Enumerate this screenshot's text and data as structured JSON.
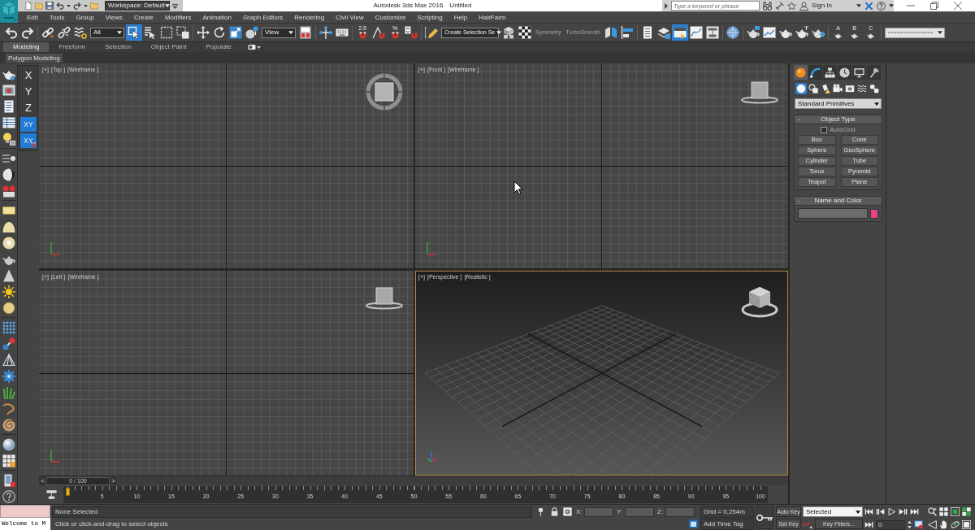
{
  "title_bar": {
    "workspace": "Workspace: Default",
    "title": "Autodesk 3ds Max 2016",
    "document": "Untitled",
    "search": {
      "placeholder": "Type a keyword or phrase"
    },
    "sign_in": "Sign In"
  },
  "menu_bar": [
    "Edit",
    "Tools",
    "Group",
    "Views",
    "Create",
    "Modifiers",
    "Animation",
    "Graph Editors",
    "Rendering",
    "Civil View",
    "Customize",
    "Scripting",
    "Help",
    "HairFarm"
  ],
  "main_toolbar": {
    "groups": [
      {
        "items": [
          {
            "kind": "button",
            "selected": false
          },
          {
            "kind": "button",
            "selected": false
          }
        ]
      },
      {
        "items": [
          {
            "kind": "button",
            "selected": false
          },
          {
            "kind": "button",
            "selected": false
          },
          {
            "kind": "button",
            "selected": false
          },
          {
            "kind": "dropdown",
            "value": "All"
          },
          {
            "kind": "button",
            "selected": true
          },
          {
            "kind": "button",
            "selected": false
          },
          {
            "kind": "button",
            "selected": false
          },
          {
            "kind": "button",
            "selected": false
          }
        ]
      },
      {
        "items": [
          {
            "kind": "button",
            "selected": false
          },
          {
            "kind": "button",
            "selected": false
          },
          {
            "kind": "button",
            "selected": false
          },
          {
            "kind": "button",
            "selected": false
          },
          {
            "kind": "dropdown",
            "value": "View"
          },
          {
            "kind": "button",
            "selected": false
          }
        ]
      },
      {
        "items": [
          {
            "kind": "button",
            "selected": false
          },
          {
            "kind": "button",
            "selected": false
          }
        ]
      },
      {
        "items": [
          {
            "kind": "button",
            "label": "2.5",
            "selected": false
          },
          {
            "kind": "button",
            "selected": false
          },
          {
            "kind": "button",
            "label": "%",
            "selected": false
          },
          {
            "kind": "button",
            "selected": false
          }
        ]
      },
      {
        "items": [
          {
            "kind": "button",
            "selected": false
          },
          {
            "kind": "field",
            "value": "Create Selection Se"
          },
          {
            "kind": "button",
            "selected": false
          },
          {
            "kind": "button",
            "selected": false
          },
          {
            "kind": "command",
            "label": "Symmetry",
            "disabled": true
          },
          {
            "kind": "command",
            "label": "TurboSmooth",
            "disabled": true
          },
          {
            "kind": "button",
            "selected": false
          },
          {
            "kind": "button",
            "selected": false
          }
        ]
      },
      {
        "items": [
          {
            "kind": "button",
            "selected": false
          },
          {
            "kind": "button",
            "selected": false
          },
          {
            "kind": "button",
            "selected": true
          },
          {
            "kind": "button",
            "selected": false
          },
          {
            "kind": "button",
            "selected": false
          }
        ]
      },
      {
        "items": [
          {
            "kind": "button",
            "selected": false
          }
        ]
      },
      {
        "items": [
          {
            "kind": "button",
            "selected": false
          },
          {
            "kind": "button",
            "selected": false
          },
          {
            "kind": "button",
            "selected": false
          },
          {
            "kind": "button",
            "selected": false
          },
          {
            "kind": "button",
            "selected": false
          }
        ]
      },
      {
        "items": [
          {
            "kind": "button",
            "label": "A",
            "selected": false
          },
          {
            "kind": "button",
            "label": "B",
            "selected": false
          },
          {
            "kind": "button",
            "label": "C",
            "selected": false
          }
        ]
      },
      {
        "items": [
          {
            "kind": "dropdown"
          }
        ]
      }
    ]
  },
  "ribbon": {
    "tabs": [
      {
        "label": "Modeling",
        "selected": true
      },
      {
        "label": "Freeform",
        "selected": false
      },
      {
        "label": "Selection",
        "selected": false
      },
      {
        "label": "Object Paint",
        "selected": false
      },
      {
        "label": "Populate",
        "selected": false
      }
    ],
    "panel": "Polygon Modeling"
  },
  "axis_constraints": [
    {
      "label": "X",
      "selected": false
    },
    {
      "label": "Y",
      "selected": false
    },
    {
      "label": "Z",
      "selected": false
    },
    {
      "label": "XY",
      "selected": true
    },
    {
      "label": "XY",
      "selected": true
    }
  ],
  "viewports": [
    {
      "kind": "orthographic",
      "labels": [
        "[+]",
        "[Top ]",
        "[Wireframe ]"
      ],
      "selected": false
    },
    {
      "kind": "orthographic",
      "labels": [
        "[+]",
        "[Front ]",
        "[Wireframe ]"
      ],
      "selected": false
    },
    {
      "kind": "orthographic",
      "labels": [
        "[+]",
        "[Left ]",
        "[Wireframe ]"
      ],
      "selected": false
    },
    {
      "kind": "perspective",
      "labels": [
        "[+]",
        "[Perspective ]",
        "[Realistic ]"
      ],
      "selected": true
    }
  ],
  "command_panel": {
    "tabs": [
      {
        "selected": true
      },
      {
        "selected": false
      },
      {
        "selected": false
      },
      {
        "selected": false
      },
      {
        "selected": false
      },
      {
        "selected": false
      }
    ],
    "categories": [
      {
        "selected": true
      },
      {
        "selected": false
      },
      {
        "selected": false
      },
      {
        "selected": false
      },
      {
        "selected": false
      },
      {
        "selected": false
      },
      {
        "selected": false
      }
    ],
    "dropdown": "Standard Primitives",
    "object_type": {
      "toggle": "-",
      "title": "Object Type",
      "autogrid": {
        "label": "AutoGrid",
        "checked": false
      },
      "buttons": [
        "Box",
        "Cone",
        "Sphere",
        "GeoSphere",
        "Cylinder",
        "Tube",
        "Torus",
        "Pyramid",
        "Teapot",
        "Plane"
      ]
    },
    "name_and_color": {
      "toggle": "-",
      "title": "Name and Color",
      "color": "#e8448c"
    }
  },
  "time_slider": {
    "prev": "<",
    "label": "0 / 100",
    "next": ">",
    "level": 0
  },
  "track_bar": {
    "ticks": [
      "5",
      "10",
      "15",
      "20",
      "25",
      "30",
      "35",
      "40",
      "45",
      "50",
      "55",
      "60",
      "65",
      "70",
      "75",
      "80",
      "85",
      "90",
      "95",
      "100"
    ]
  },
  "status": {
    "listener": "Welcome to M",
    "selection": "None Selected",
    "prompt": "Click or click-and-drag to select objects",
    "coordinates": [
      "X:",
      "Y:",
      "Z:"
    ],
    "grid": "Grid = 0,254m",
    "time_tag": "Add Time Tag"
  },
  "animation": {
    "auto_key": "Auto Key",
    "set_key": "Set Key",
    "key_set": "Selected",
    "key_filters": "Key Filters...",
    "frame": "0"
  }
}
